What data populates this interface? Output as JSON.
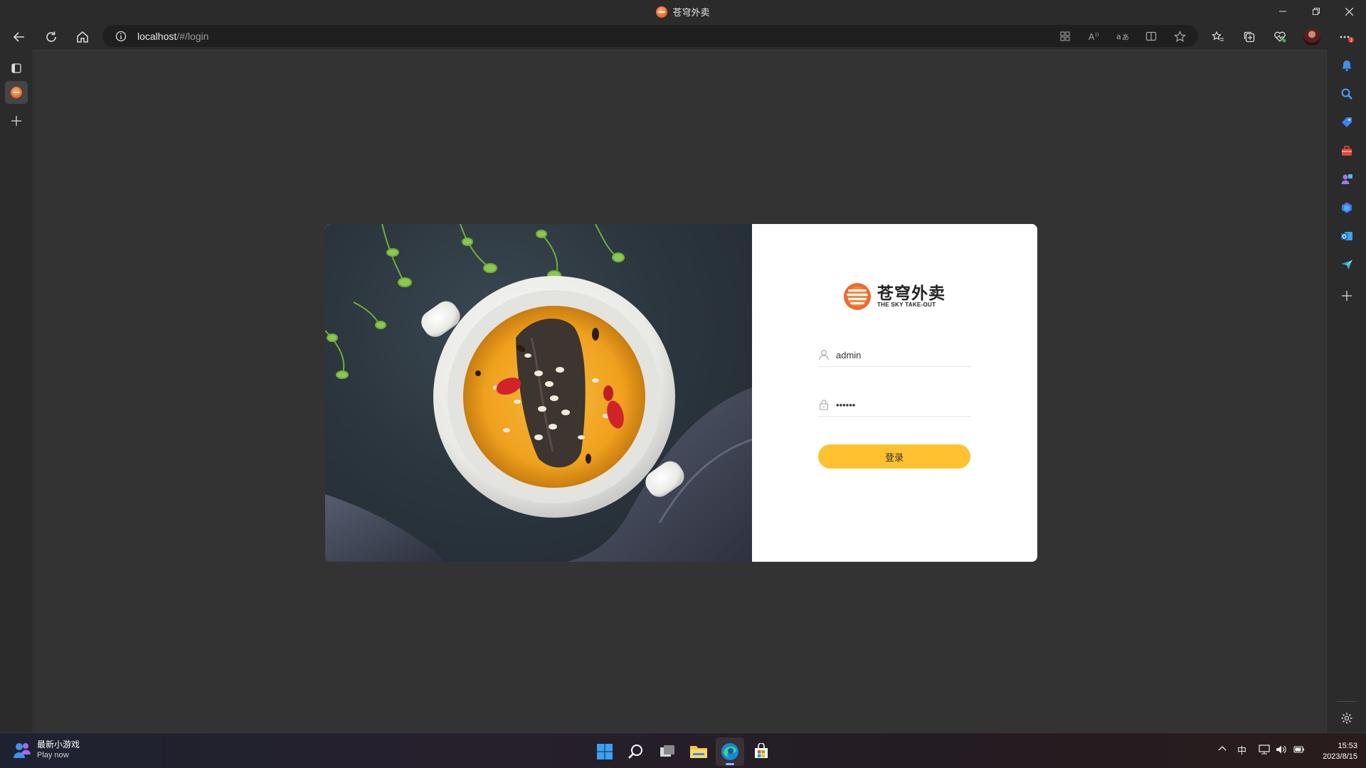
{
  "window": {
    "title": "苍穹外卖"
  },
  "toolbar": {
    "url_host": "localhost",
    "url_path": "/#/login"
  },
  "login": {
    "logo_cn": "苍穹外卖",
    "logo_en": "THE SKY TAKE-OUT",
    "username_value": "admin",
    "password_value": "••••••",
    "submit_label": "登录"
  },
  "taskbar": {
    "widget_title": "最新小游戏",
    "widget_subtitle": "Play now",
    "ime_indicator": "中",
    "time": "15:53",
    "date": "2023/8/15"
  },
  "colors": {
    "accent": "#ffc130",
    "logo_orange": "#ef6a2a",
    "background": "#333333"
  },
  "icons": {
    "left_rail": [
      "tab-actions-icon",
      "site-favicon-icon",
      "new-tab-icon"
    ],
    "right_rail": [
      "bell-icon",
      "search-icon",
      "shopping-tag-icon",
      "tools-icon",
      "games-icon",
      "copilot-icon",
      "outlook-icon",
      "send-icon",
      "add-icon",
      "settings-icon"
    ]
  }
}
